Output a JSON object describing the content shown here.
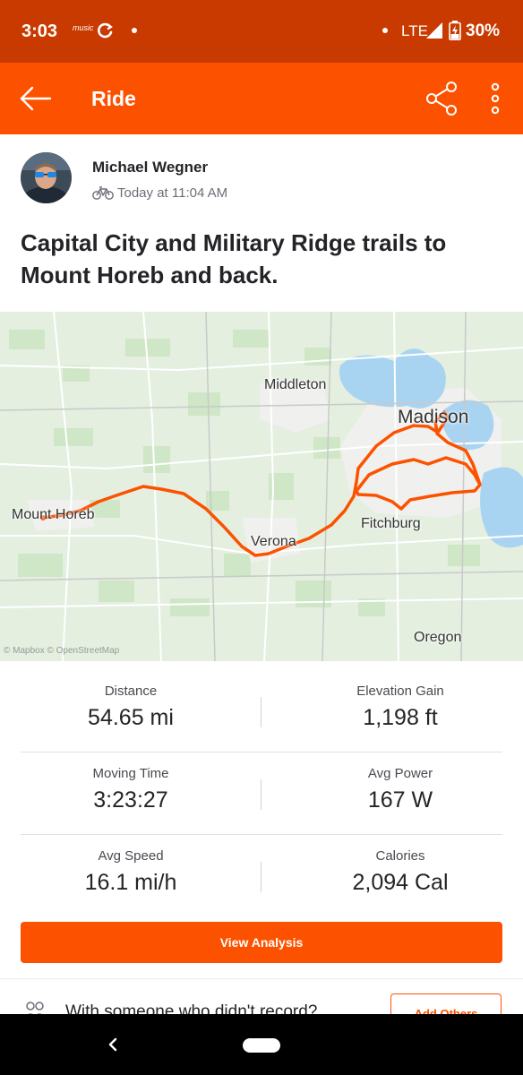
{
  "status_bar": {
    "time": "3:03",
    "music_label": "music",
    "network": "LTE",
    "battery": "30%",
    "icons": [
      "amazon-music-icon",
      "sync-icon",
      "notification-dot-icon",
      "signal-icon",
      "battery-charging-icon"
    ]
  },
  "app_bar": {
    "title": "Ride",
    "background_color": "#fc5200",
    "icons": [
      "back-arrow-icon",
      "share-icon",
      "more-vert-icon"
    ]
  },
  "athlete": {
    "name": "Michael Wegner",
    "timestamp": "Today at 11:04 AM",
    "activity_icon": "bike-icon"
  },
  "activity": {
    "title": "Capital City and Military Ridge trails to Mount Horeb and back."
  },
  "map": {
    "labels": {
      "middleton": "Middleton",
      "madison": "Madison",
      "mount_horeb": "Mount Horeb",
      "verona": "Verona",
      "fitchburg": "Fitchburg",
      "oregon": "Oregon"
    },
    "attribution": "© Mapbox © OpenStreetMap",
    "route_color": "#fc5200"
  },
  "stats": [
    {
      "label": "Distance",
      "value": "54.65 mi"
    },
    {
      "label": "Elevation Gain",
      "value": "1,198 ft"
    },
    {
      "label": "Moving Time",
      "value": "3:23:27"
    },
    {
      "label": "Avg Power",
      "value": "167 W"
    },
    {
      "label": "Avg Speed",
      "value": "16.1 mi/h"
    },
    {
      "label": "Calories",
      "value": "2,094 Cal"
    }
  ],
  "actions": {
    "view_analysis": "View Analysis",
    "with_someone": "With someone who didn't record?",
    "add_others": "Add Others"
  }
}
